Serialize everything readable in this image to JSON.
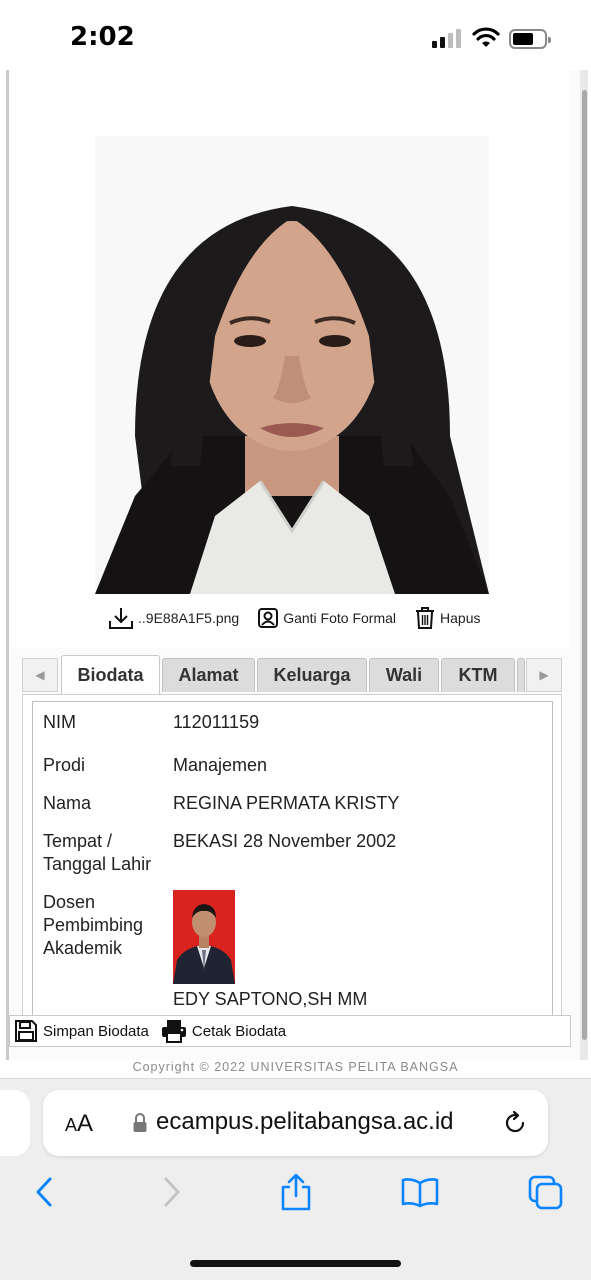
{
  "status_bar": {
    "time": "2:02",
    "signal_icon": "cellular-signal-icon",
    "wifi_icon": "wifi-icon",
    "battery_icon": "battery-icon",
    "battery_level": 0.6
  },
  "photo_panel": {
    "photo_icon": "student-portrait-photo",
    "actions": {
      "download_label": "..9E88A1F5.png",
      "change_label": "Ganti Foto Formal",
      "delete_label": "Hapus"
    }
  },
  "tabs": {
    "items": [
      {
        "label": "Biodata",
        "active": true
      },
      {
        "label": "Alamat",
        "active": false
      },
      {
        "label": "Keluarga",
        "active": false
      },
      {
        "label": "Wali",
        "active": false
      },
      {
        "label": "KTM",
        "active": false
      }
    ]
  },
  "biodata": {
    "nim_label": "NIM",
    "nim_value": "112011159",
    "prodi_label": "Prodi",
    "prodi_value": "Manajemen",
    "nama_label": "Nama",
    "nama_value": "REGINA PERMATA KRISTY",
    "ttl_label_line1": "Tempat /",
    "ttl_label_line2": "Tanggal Lahir",
    "ttl_value": "BEKASI 28 November 2002",
    "dosen_label_line1": "Dosen",
    "dosen_label_line2": "Pembimbing",
    "dosen_label_line3": "Akademik",
    "dosen_photo_icon": "advisor-portrait-photo",
    "dosen_value": "EDY SAPTONO,SH MM"
  },
  "toolbar": {
    "save_label": "Simpan Biodata",
    "print_label": "Cetak Biodata"
  },
  "footer": {
    "copyright": "Copyright © 2022 UNIVERSITAS PELITA BANGSA"
  },
  "browser": {
    "text_size_label": "AA",
    "url": "ecampus.pelitabangsa.ac.id",
    "accent": "#0a84ff"
  }
}
